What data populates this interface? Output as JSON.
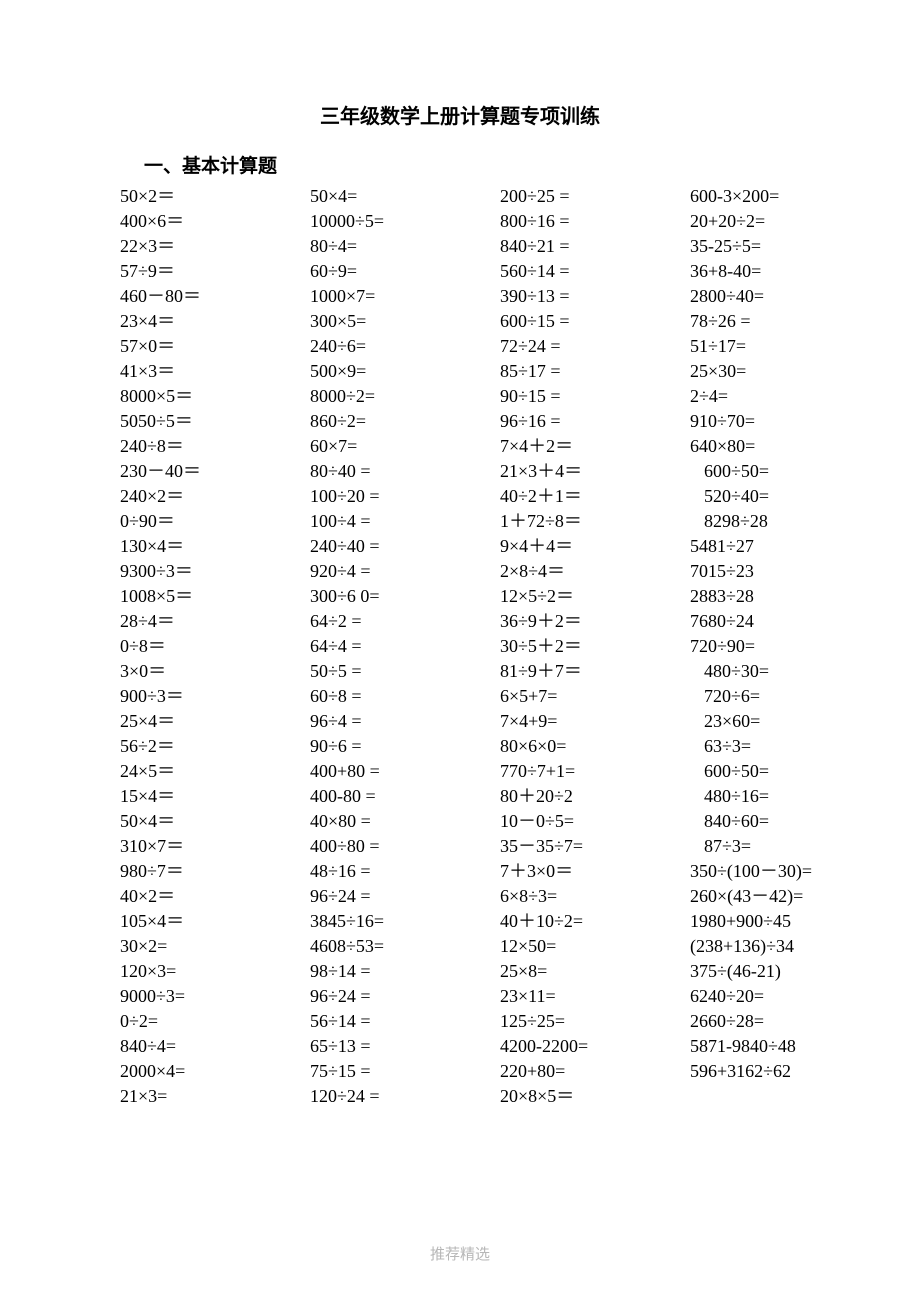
{
  "title": "三年级数学上册计算题专项训练",
  "section1_header": "一、基本计算题",
  "footer": "推荐精选",
  "columns": {
    "col1": [
      "50×2＝",
      "400×6＝",
      "22×3＝",
      "57÷9＝",
      "460－80＝",
      "23×4＝",
      "57×0＝",
      "41×3＝",
      "8000×5＝",
      "5050÷5＝",
      "240÷8＝",
      "230－40＝",
      "240×2＝",
      "0÷90＝",
      "130×4＝",
      "9300÷3＝",
      "1008×5＝",
      "28÷4＝",
      "0÷8＝",
      "3×0＝",
      "900÷3＝",
      "25×4＝",
      "56÷2＝",
      "24×5＝",
      "15×4＝",
      "50×4＝",
      "310×7＝",
      "980÷7＝",
      "40×2＝",
      "105×4＝",
      "30×2=",
      "120×3=",
      "9000÷3=",
      "0÷2=",
      "840÷4=",
      "2000×4=",
      "21×3="
    ],
    "col2": [
      "50×4=",
      "10000÷5=",
      "80÷4=",
      "60÷9=",
      "1000×7=",
      "300×5=",
      "240÷6=",
      "500×9=",
      "8000÷2=",
      "860÷2=",
      "60×7=",
      "80÷40 =",
      "100÷20 =",
      "100÷4 =",
      "240÷40 =",
      "920÷4 =",
      "300÷6 0=",
      "64÷2 =",
      "64÷4 =",
      "50÷5 =",
      "60÷8 =",
      "96÷4 =",
      "90÷6 =",
      "400+80 =",
      "400-80 =",
      "40×80 =",
      "400÷80 =",
      "48÷16 =",
      "96÷24 =",
      "3845÷16=",
      "4608÷53=",
      "98÷14 =",
      "96÷24 =",
      "56÷14 =",
      "65÷13 =",
      "75÷15 =",
      "120÷24 ="
    ],
    "col3": [
      "200÷25 =",
      "800÷16 =",
      "840÷21 =",
      "560÷14 =",
      "390÷13 =",
      "600÷15 =",
      "72÷24 =",
      "85÷17 =",
      "90÷15 =",
      "96÷16 =",
      "7×4＋2＝",
      "21×3＋4＝",
      "40÷2＋1＝",
      "1＋72÷8＝",
      "9×4＋4＝",
      "2×8÷4＝",
      "12×5÷2＝",
      "36÷9＋2＝",
      "30÷5＋2＝",
      "81÷9＋7＝",
      "6×5+7=",
      "7×4+9=",
      "80×6×0=",
      "770÷7+1=",
      "80＋20÷2",
      "10－0÷5=",
      "35－35÷7=",
      "7＋3×0＝",
      "6×8÷3=",
      "40＋10÷2=",
      "12×50=",
      "25×8=",
      "23×11=",
      "125÷25=",
      "4200-2200=",
      "220+80=",
      "20×8×5＝"
    ],
    "col4": [
      {
        "t": "600-3×200=",
        "i": false
      },
      {
        "t": "20+20÷2=",
        "i": false
      },
      {
        "t": "35-25÷5=",
        "i": false
      },
      {
        "t": "36+8-40=",
        "i": false
      },
      {
        "t": "2800÷40=",
        "i": false
      },
      {
        "t": "78÷26 =",
        "i": false
      },
      {
        "t": "51÷17=",
        "i": false
      },
      {
        "t": "25×30=",
        "i": false
      },
      {
        "t": "2÷4=",
        "i": false
      },
      {
        "t": "910÷70=",
        "i": false
      },
      {
        "t": "640×80=",
        "i": false
      },
      {
        "t": "600÷50=",
        "i": true
      },
      {
        "t": "520÷40=",
        "i": true
      },
      {
        "t": "8298÷28",
        "i": true
      },
      {
        "t": "5481÷27",
        "i": false
      },
      {
        "t": "7015÷23",
        "i": false
      },
      {
        "t": "2883÷28",
        "i": false
      },
      {
        "t": "7680÷24",
        "i": false
      },
      {
        "t": "720÷90=",
        "i": false
      },
      {
        "t": "480÷30=",
        "i": true
      },
      {
        "t": "720÷6=",
        "i": true
      },
      {
        "t": "23×60=",
        "i": true
      },
      {
        "t": "63÷3=",
        "i": true
      },
      {
        "t": "600÷50=",
        "i": true
      },
      {
        "t": "480÷16=",
        "i": true
      },
      {
        "t": "840÷60=",
        "i": true
      },
      {
        "t": "87÷3=",
        "i": true
      },
      {
        "t": "350÷(100－30)=",
        "i": false
      },
      {
        "t": "260×(43－42)=",
        "i": false
      },
      {
        "t": "1980+900÷45",
        "i": false
      },
      {
        "t": "(238+136)÷34",
        "i": false
      },
      {
        "t": "375÷(46-21)",
        "i": false
      },
      {
        "t": "6240÷20=",
        "i": false
      },
      {
        "t": "2660÷28=",
        "i": false
      },
      {
        "t": "5871-9840÷48",
        "i": false
      },
      {
        "t": "596+3162÷62",
        "i": false
      }
    ]
  }
}
